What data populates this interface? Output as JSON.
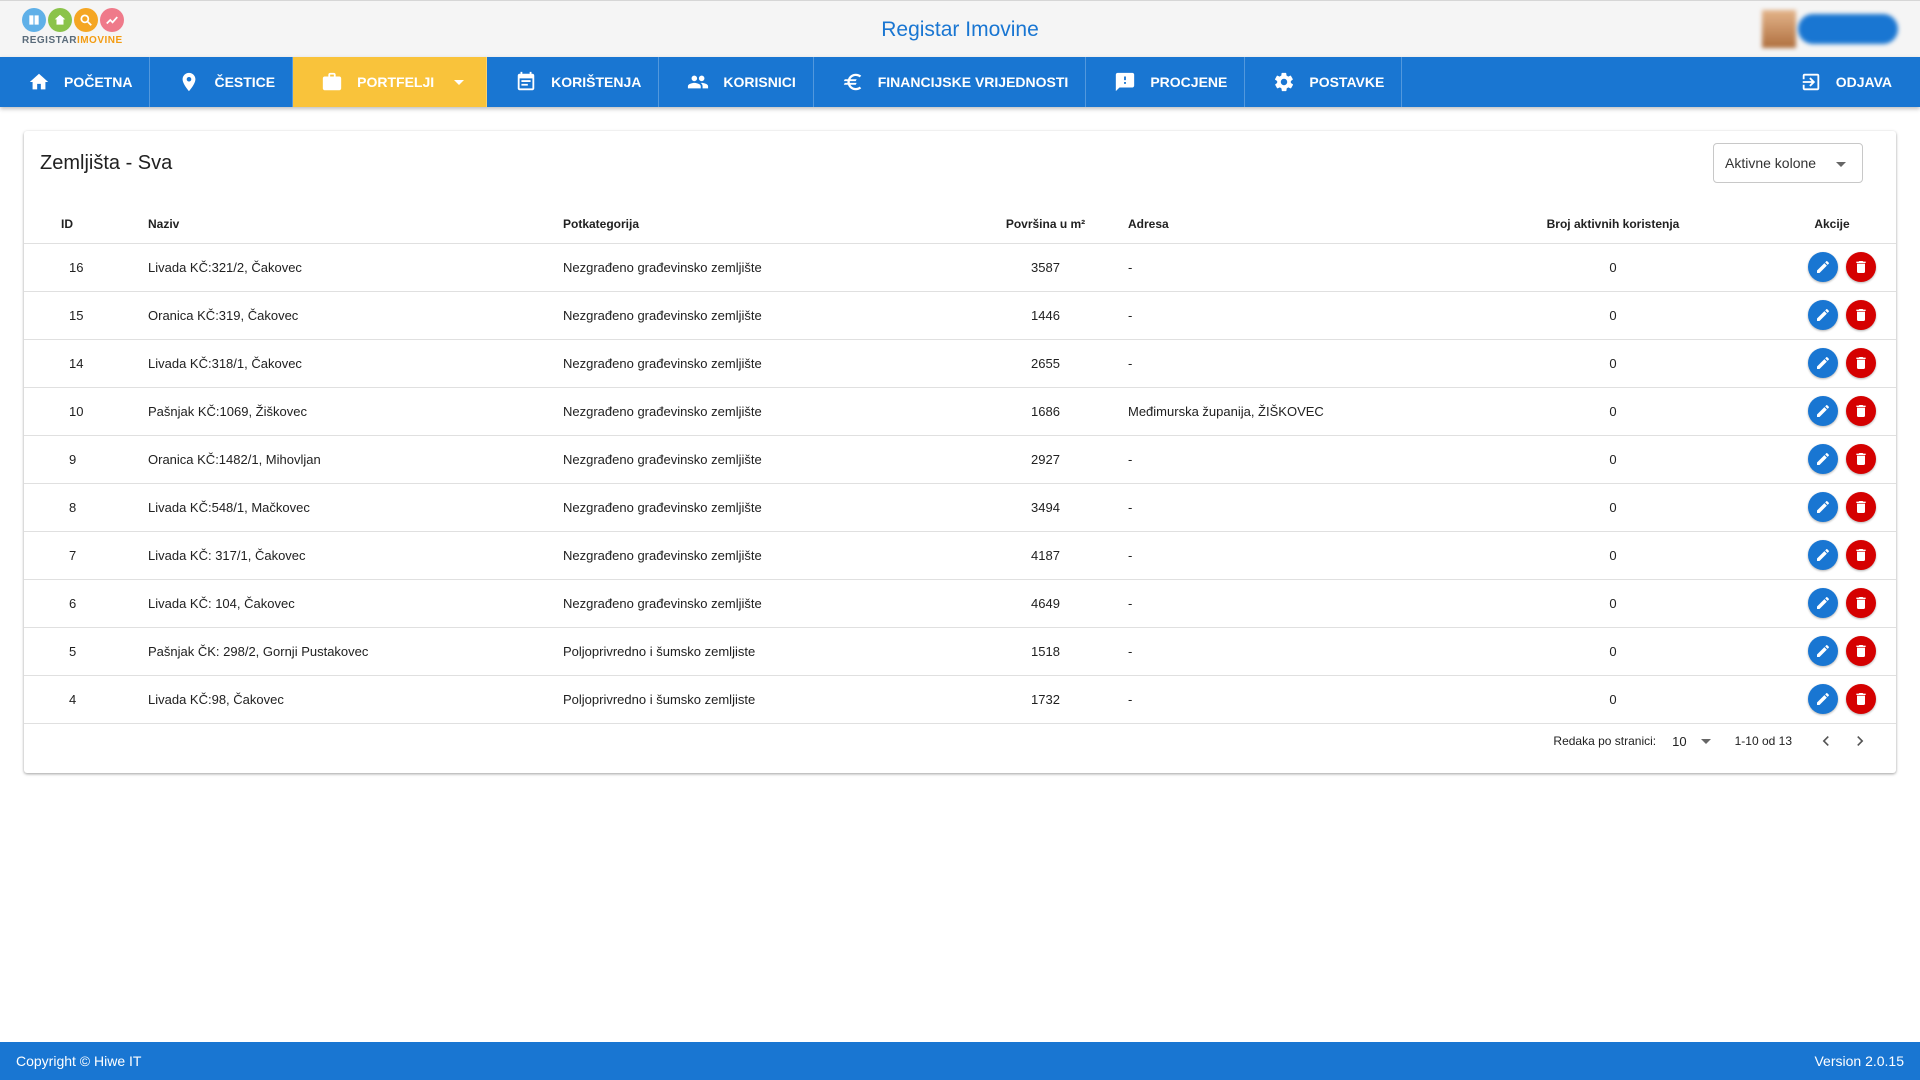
{
  "header": {
    "logo_text_main": "REGISTAR",
    "logo_text_accent": "IMOVINE",
    "title": "Registar Imovine"
  },
  "nav": {
    "items": [
      {
        "label": "POČETNA",
        "icon": "home-icon"
      },
      {
        "label": "ČESTICE",
        "icon": "location-pin-icon"
      },
      {
        "label": "PORTFELJI",
        "icon": "briefcase-icon",
        "active": true
      },
      {
        "label": "KORIŠTENJA",
        "icon": "calendar-icon"
      },
      {
        "label": "KORISNICI",
        "icon": "people-icon"
      },
      {
        "label": "FINANCIJSKE VRIJEDNOSTI",
        "icon": "euro-icon"
      },
      {
        "label": "PROCJENE",
        "icon": "feedback-icon"
      },
      {
        "label": "POSTAVKE",
        "icon": "gear-icon"
      }
    ],
    "logout_label": "ODJAVA"
  },
  "card": {
    "title": "Zemljišta - Sva",
    "columns_select_label": "Aktivne kolone"
  },
  "table": {
    "headers": {
      "id": "ID",
      "naziv": "Naziv",
      "potkategorija": "Potkategorija",
      "povrsina": "Površina u m²",
      "adresa": "Adresa",
      "broj": "Broj aktivnih koristenja",
      "akcije": "Akcije"
    },
    "rows": [
      {
        "id": "16",
        "naziv": "Livada KČ:321/2, Čakovec",
        "potkategorija": "Nezgrađeno građevinsko zemljište",
        "povrsina": "3587",
        "adresa": "-",
        "broj": "0"
      },
      {
        "id": "15",
        "naziv": "Oranica KČ:319, Čakovec",
        "potkategorija": "Nezgrađeno građevinsko zemljište",
        "povrsina": "1446",
        "adresa": "-",
        "broj": "0"
      },
      {
        "id": "14",
        "naziv": "Livada KČ:318/1, Čakovec",
        "potkategorija": "Nezgrađeno građevinsko zemljište",
        "povrsina": "2655",
        "adresa": "-",
        "broj": "0"
      },
      {
        "id": "10",
        "naziv": "Pašnjak KČ:1069, Žiškovec",
        "potkategorija": "Nezgrađeno građevinsko zemljište",
        "povrsina": "1686",
        "adresa": "Međimurska županija, ŽIŠKOVEC",
        "broj": "0"
      },
      {
        "id": "9",
        "naziv": "Oranica KČ:1482/1, Mihovljan",
        "potkategorija": "Nezgrađeno građevinsko zemljište",
        "povrsina": "2927",
        "adresa": "-",
        "broj": "0"
      },
      {
        "id": "8",
        "naziv": "Livada KČ:548/1, Mačkovec",
        "potkategorija": "Nezgrađeno građevinsko zemljište",
        "povrsina": "3494",
        "adresa": "-",
        "broj": "0"
      },
      {
        "id": "7",
        "naziv": "Livada KČ: 317/1, Čakovec",
        "potkategorija": "Nezgrađeno građevinsko zemljište",
        "povrsina": "4187",
        "adresa": "-",
        "broj": "0"
      },
      {
        "id": "6",
        "naziv": "Livada KČ: 104, Čakovec",
        "potkategorija": "Nezgrađeno građevinsko zemljište",
        "povrsina": "4649",
        "adresa": "-",
        "broj": "0"
      },
      {
        "id": "5",
        "naziv": "Pašnjak ČK: 298/2, Gornji Pustakovec",
        "potkategorija": "Poljoprivredno i šumsko zemljiste",
        "povrsina": "1518",
        "adresa": "-",
        "broj": "0"
      },
      {
        "id": "4",
        "naziv": "Livada KČ:98, Čakovec",
        "potkategorija": "Poljoprivredno i šumsko zemljiste",
        "povrsina": "1732",
        "adresa": "-",
        "broj": "0"
      }
    ]
  },
  "pager": {
    "rows_per_page_label": "Redaka po stranici:",
    "rows_per_page_value": "10",
    "range": "1-10 od 13"
  },
  "footer": {
    "copyright": "Copyright © Hiwe IT",
    "version": "Version 2.0.15"
  },
  "colors": {
    "primary": "#1976d2",
    "active_nav": "#f9c33b",
    "delete": "#d50000"
  }
}
